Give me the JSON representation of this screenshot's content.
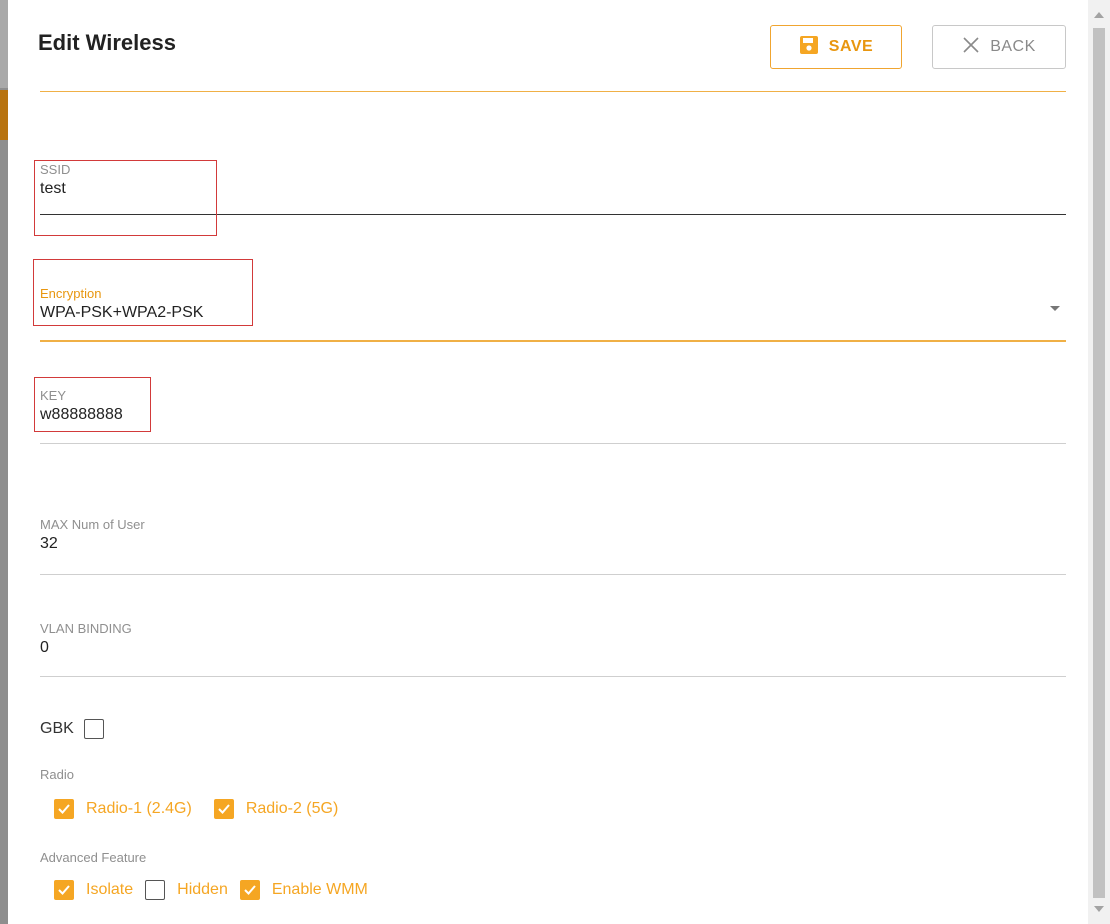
{
  "dialog": {
    "title": "Edit Wireless",
    "save_label": "SAVE",
    "back_label": "BACK"
  },
  "fields": {
    "ssid": {
      "label": "SSID",
      "value": "test"
    },
    "encryption": {
      "label": "Encryption",
      "value": "WPA-PSK+WPA2-PSK"
    },
    "key": {
      "label": "KEY",
      "value": "w88888888"
    },
    "max_users": {
      "label": "MAX Num of User",
      "value": "32"
    },
    "vlan": {
      "label": "VLAN BINDING",
      "value": "0"
    }
  },
  "gbk": {
    "label": "GBK",
    "checked": false
  },
  "radio": {
    "label": "Radio",
    "options": [
      {
        "label": "Radio-1 (2.4G)",
        "checked": true
      },
      {
        "label": "Radio-2 (5G)",
        "checked": true
      }
    ]
  },
  "advanced": {
    "label": "Advanced Feature",
    "options": [
      {
        "label": "Isolate",
        "checked": true
      },
      {
        "label": "Hidden",
        "checked": false
      },
      {
        "label": "Enable WMM",
        "checked": true
      }
    ]
  },
  "colors": {
    "accent": "#f5a623",
    "annotation": "#d23a3a"
  }
}
